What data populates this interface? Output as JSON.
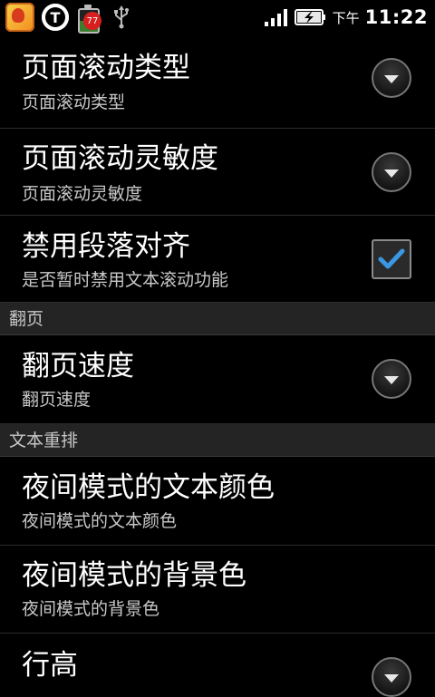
{
  "status_bar": {
    "badge_count": "77",
    "ampm": "下午",
    "time": "11:22",
    "gear_letter": "T",
    "icons": [
      "app-launcher-icon",
      "gear-t-icon",
      "battery-widget-icon",
      "usb-icon",
      "signal-icon",
      "battery-charging-icon"
    ]
  },
  "settings": {
    "scroll_type": {
      "title": "页面滚动类型",
      "summary": "页面滚动类型"
    },
    "scroll_sensitivity": {
      "title": "页面滚动灵敏度",
      "summary": "页面滚动灵敏度"
    },
    "disable_align": {
      "title": "禁用段落对齐",
      "summary": "是否暂时禁用文本滚动功能",
      "checked": true
    },
    "section_page_turn": "翻页",
    "page_turn_speed": {
      "title": "翻页速度",
      "summary": "翻页速度"
    },
    "section_reflow": "文本重排",
    "night_text_color": {
      "title": "夜间模式的文本颜色",
      "summary": "夜间模式的文本颜色"
    },
    "night_bg_color": {
      "title": "夜间模式的背景色",
      "summary": "夜间模式的背景色"
    },
    "line_height": {
      "title": "行高"
    }
  },
  "colors": {
    "background": "#000000",
    "section_bg": "#242424",
    "check_accent": "#3a97e4"
  }
}
